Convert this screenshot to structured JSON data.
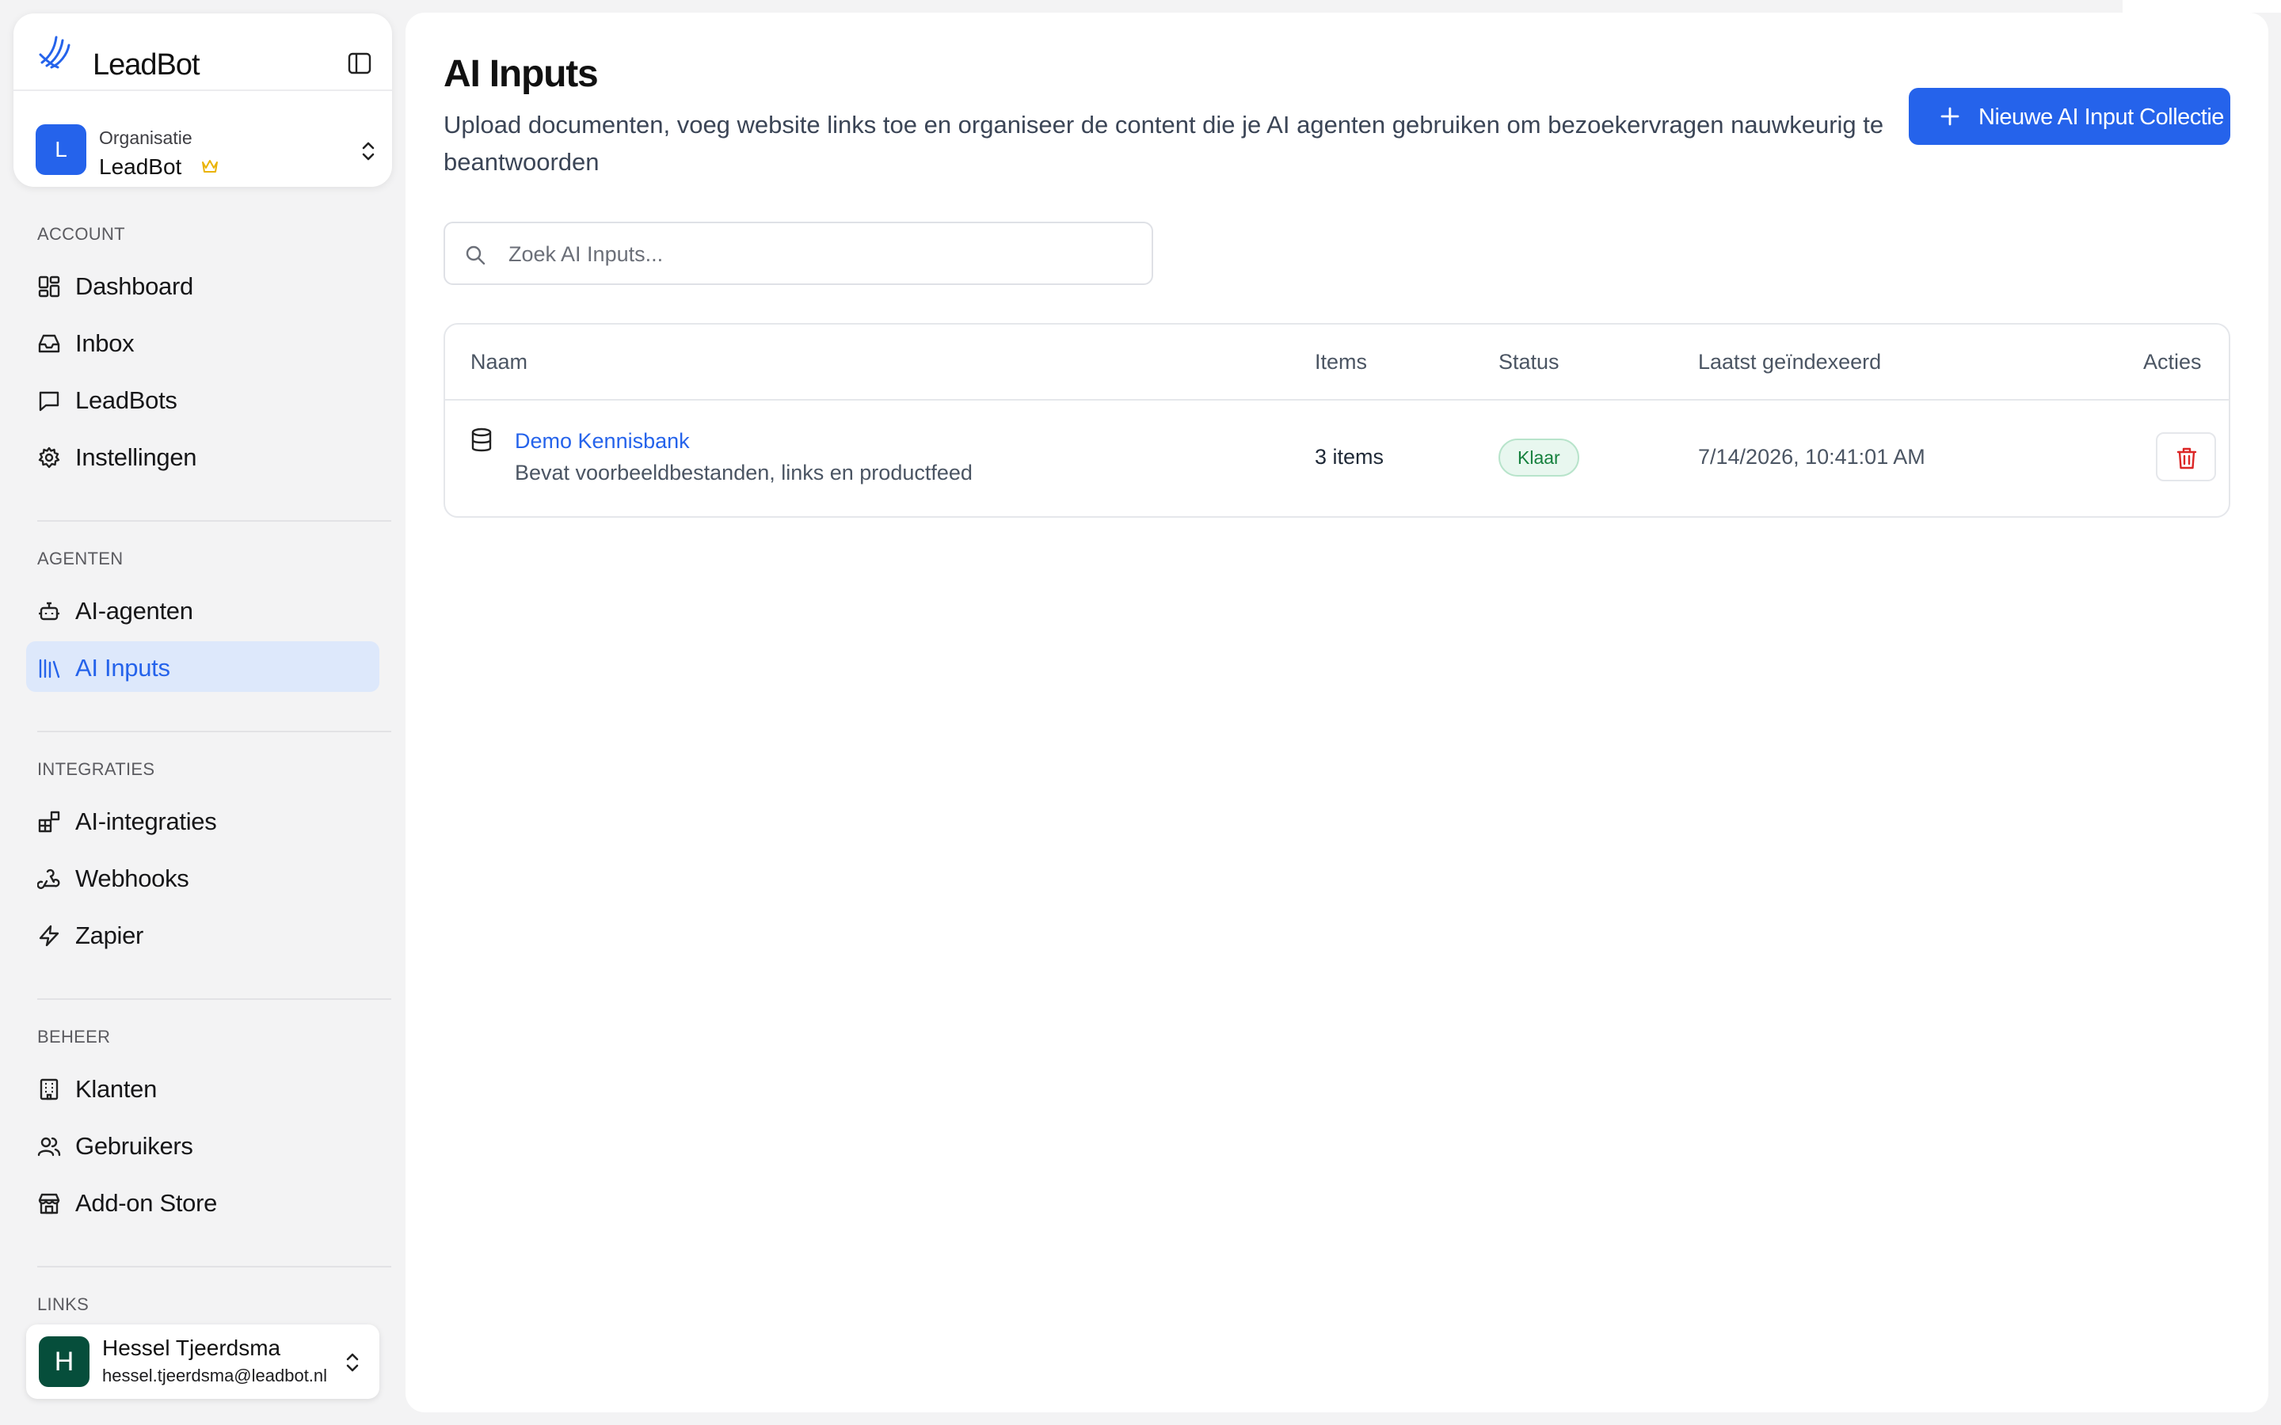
{
  "brand": {
    "name": "LeadBot"
  },
  "organization": {
    "label": "Organisatie",
    "name": "LeadBot",
    "avatar_letter": "L",
    "avatar_color": "#2563eb"
  },
  "sidebar": {
    "sections": [
      {
        "title": "ACCOUNT",
        "items": [
          {
            "label": "Dashboard",
            "icon": "dashboard-icon"
          },
          {
            "label": "Inbox",
            "icon": "inbox-icon"
          },
          {
            "label": "LeadBots",
            "icon": "chat-icon"
          },
          {
            "label": "Instellingen",
            "icon": "gear-icon"
          }
        ]
      },
      {
        "title": "AGENTEN",
        "items": [
          {
            "label": "AI-agenten",
            "icon": "bot-icon"
          },
          {
            "label": "AI Inputs",
            "icon": "library-icon",
            "active": true
          }
        ]
      },
      {
        "title": "INTEGRATIES",
        "items": [
          {
            "label": "AI-integraties",
            "icon": "blocks-icon"
          },
          {
            "label": "Webhooks",
            "icon": "webhook-icon"
          },
          {
            "label": "Zapier",
            "icon": "zap-icon"
          }
        ]
      },
      {
        "title": "BEHEER",
        "items": [
          {
            "label": "Klanten",
            "icon": "building-icon"
          },
          {
            "label": "Gebruikers",
            "icon": "users-icon"
          },
          {
            "label": "Add-on Store",
            "icon": "store-icon"
          }
        ]
      },
      {
        "title": "LINKS",
        "items": []
      }
    ]
  },
  "user": {
    "name": "Hessel Tjeerdsma",
    "email": "hessel.tjeerdsma@leadbot.nl",
    "avatar_letter": "H",
    "avatar_color": "#064e3b"
  },
  "page": {
    "title": "AI Inputs",
    "subtitle": "Upload documenten, voeg website links toe en organiseer de content die je AI agenten gebruiken om bezoekervragen nauwkeurig te beantwoorden",
    "new_button_label": "Nieuwe AI Input Collectie"
  },
  "search": {
    "placeholder": "Zoek AI Inputs..."
  },
  "table": {
    "headers": {
      "name": "Naam",
      "items": "Items",
      "status": "Status",
      "indexed": "Laatst geïndexeerd",
      "actions": "Acties"
    },
    "rows": [
      {
        "name": "Demo Kennisbank",
        "description": "Bevat voorbeeldbestanden, links en productfeed",
        "items": "3 items",
        "status": "Klaar",
        "indexed": "7/14/2026, 10:41:01 AM"
      }
    ]
  },
  "colors": {
    "accent": "#2563eb",
    "active_bg": "#dde8fb",
    "success": "#15803d",
    "danger": "#dc2626"
  }
}
